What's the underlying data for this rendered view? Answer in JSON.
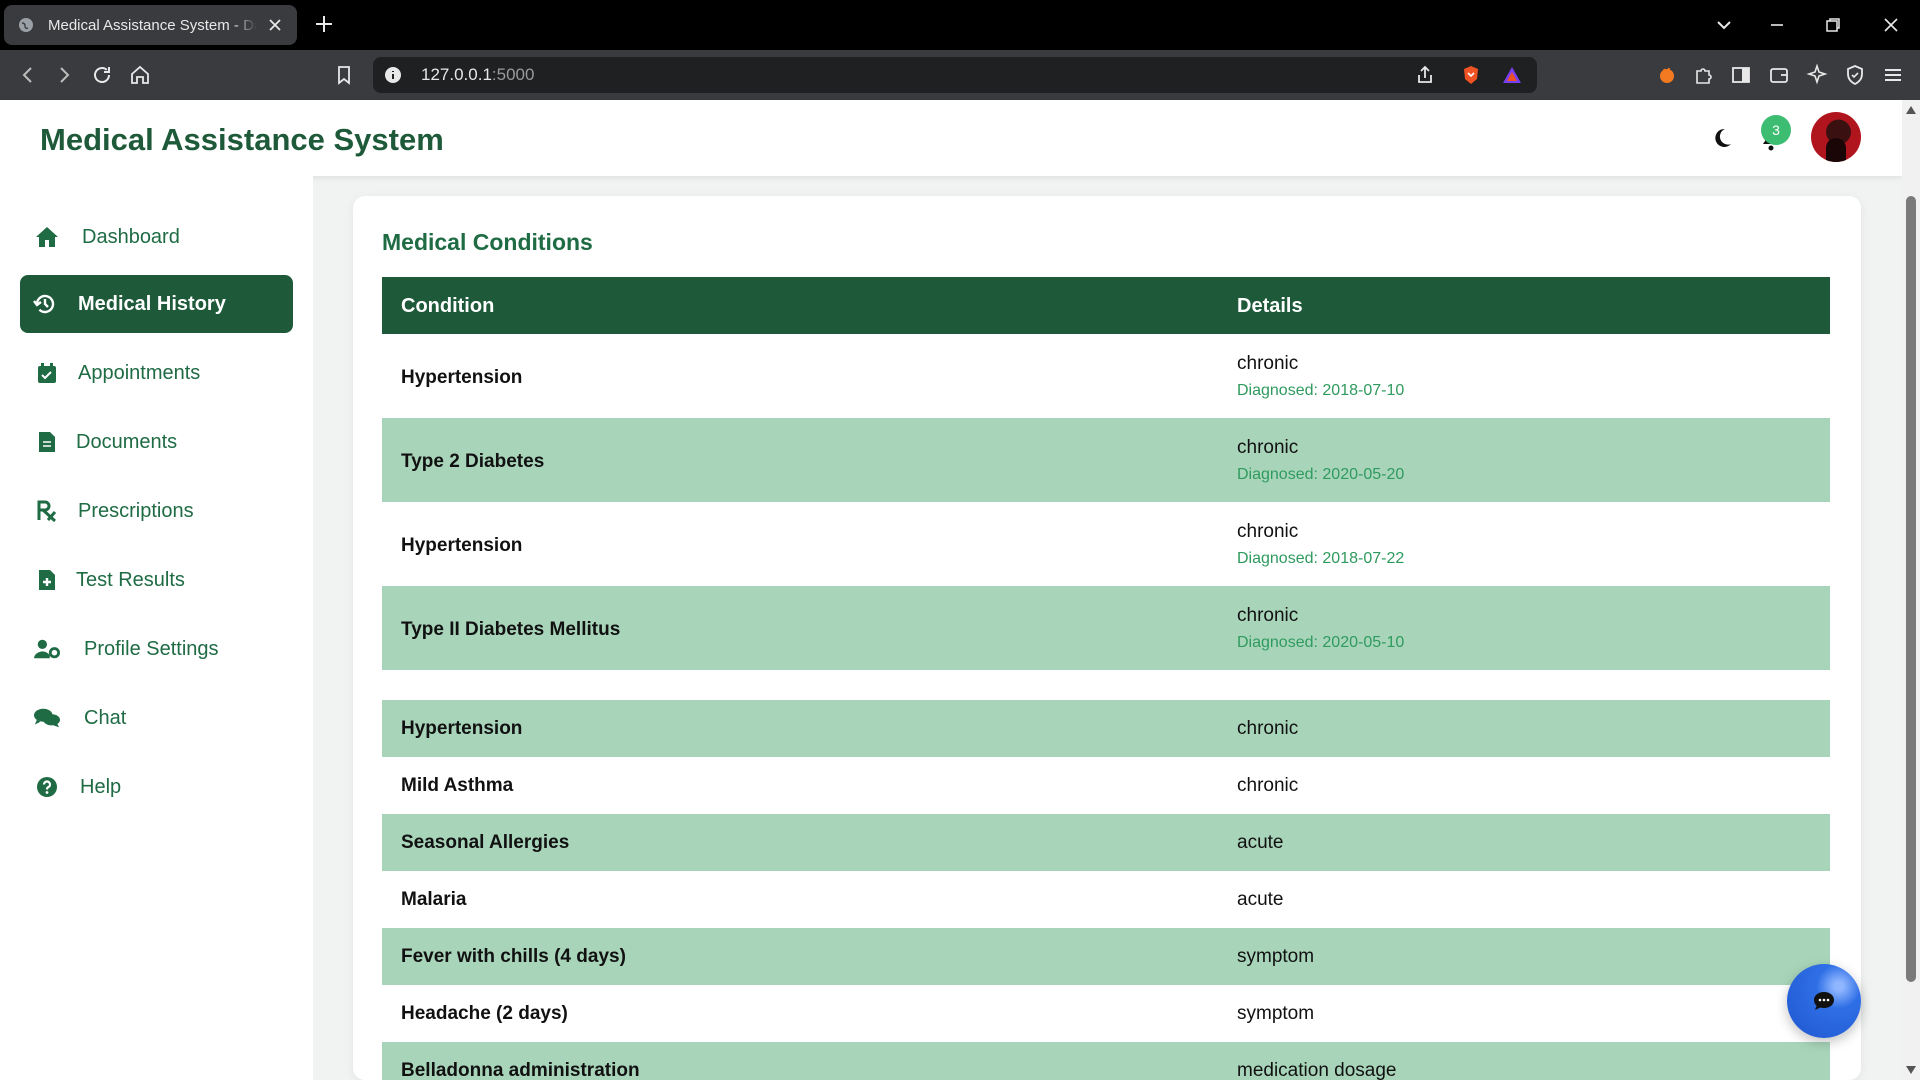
{
  "browser": {
    "tab_title": "Medical Assistance System - Dashboard",
    "url_host": "127.0.0.1",
    "url_port": ":5000"
  },
  "header": {
    "title": "Medical Assistance System",
    "notification_count": "3"
  },
  "sidebar": {
    "items": [
      {
        "label": "Dashboard",
        "icon": "home-icon"
      },
      {
        "label": "Medical History",
        "icon": "history-icon",
        "active": true
      },
      {
        "label": "Appointments",
        "icon": "calendar-check-icon"
      },
      {
        "label": "Documents",
        "icon": "file-icon"
      },
      {
        "label": "Prescriptions",
        "icon": "prescription-icon"
      },
      {
        "label": "Test Results",
        "icon": "file-medical-icon"
      },
      {
        "label": "Profile Settings",
        "icon": "user-cog-icon"
      },
      {
        "label": "Chat",
        "icon": "comments-icon"
      },
      {
        "label": "Help",
        "icon": "question-circle-icon"
      }
    ]
  },
  "main": {
    "section_title": "Medical Conditions",
    "columns": [
      "Condition",
      "Details"
    ],
    "rows_detailed": [
      {
        "condition": "Hypertension",
        "details": "chronic",
        "diagnosed": "Diagnosed: 2018-07-10"
      },
      {
        "condition": "Type 2 Diabetes",
        "details": "chronic",
        "diagnosed": "Diagnosed: 2020-05-20"
      },
      {
        "condition": "Hypertension",
        "details": "chronic",
        "diagnosed": "Diagnosed: 2018-07-22"
      },
      {
        "condition": "Type II Diabetes Mellitus",
        "details": "chronic",
        "diagnosed": "Diagnosed: 2020-05-10"
      }
    ],
    "rows_simple": [
      {
        "condition": "Hypertension",
        "details": "chronic"
      },
      {
        "condition": "Mild Asthma",
        "details": "chronic"
      },
      {
        "condition": "Seasonal Allergies",
        "details": "acute"
      },
      {
        "condition": "Malaria",
        "details": "acute"
      },
      {
        "condition": "Fever with chills (4 days)",
        "details": "symptom"
      },
      {
        "condition": "Headache (2 days)",
        "details": "symptom"
      },
      {
        "condition": "Belladonna administration",
        "details": "medication dosage"
      }
    ]
  },
  "colors": {
    "primary": "#1e5a3a",
    "accent_text": "#1e6b44",
    "row_alt": "#a8d5ba",
    "badge": "#3dbd72",
    "fab": "#2f6fe6"
  }
}
